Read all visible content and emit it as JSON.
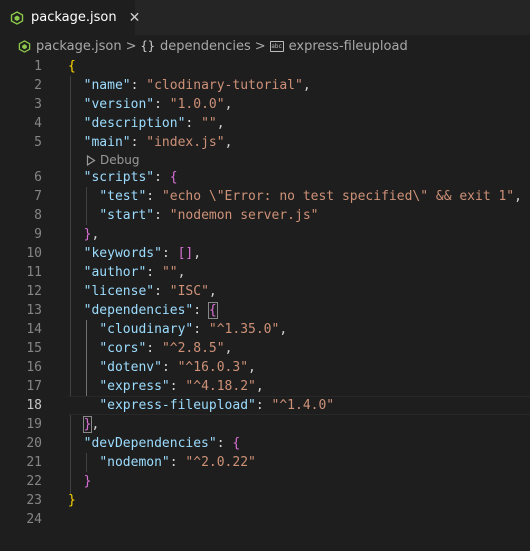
{
  "tab": {
    "filename": "package.json",
    "close_glyph": "✕",
    "icon": "nodejs-icon"
  },
  "breadcrumbs": [
    {
      "label": "package.json",
      "icon": "nodejs-icon"
    },
    {
      "label": "dependencies",
      "icon": "braces-icon"
    },
    {
      "label": "express-fileupload",
      "icon": "string-icon"
    }
  ],
  "breadcrumb_separator": ">",
  "braces_glyph": "{}",
  "string_glyph": "abc",
  "codelens": {
    "label": "Debug",
    "icon": "play-icon"
  },
  "active_line": 18,
  "colors": {
    "background": "#1e1e1e",
    "key": "#9cdcfe",
    "string": "#ce9178",
    "punctuation": "#d4d4d4",
    "bracket_level_1": "#ffd700",
    "bracket_level_2": "#da70d6",
    "bracket_level_3": "#179fff",
    "nodejs_green": "#8cc84b"
  },
  "code": {
    "lines": [
      {
        "n": "1",
        "t": [
          [
            "b1",
            "{"
          ]
        ]
      },
      {
        "n": "2",
        "t": [
          [
            "p",
            "  "
          ],
          [
            "k",
            "\"name\""
          ],
          [
            "p",
            ": "
          ],
          [
            "s",
            "\"clodinary-tutorial\""
          ],
          [
            "p",
            ","
          ]
        ]
      },
      {
        "n": "3",
        "t": [
          [
            "p",
            "  "
          ],
          [
            "k",
            "\"version\""
          ],
          [
            "p",
            ": "
          ],
          [
            "s",
            "\"1.0.0\""
          ],
          [
            "p",
            ","
          ]
        ]
      },
      {
        "n": "4",
        "t": [
          [
            "p",
            "  "
          ],
          [
            "k",
            "\"description\""
          ],
          [
            "p",
            ": "
          ],
          [
            "s",
            "\"\""
          ],
          [
            "p",
            ","
          ]
        ]
      },
      {
        "n": "5",
        "t": [
          [
            "p",
            "  "
          ],
          [
            "k",
            "\"main\""
          ],
          [
            "p",
            ": "
          ],
          [
            "s",
            "\"index.js\""
          ],
          [
            "p",
            ","
          ]
        ]
      },
      {
        "n": "6",
        "t": [
          [
            "p",
            "  "
          ],
          [
            "k",
            "\"scripts\""
          ],
          [
            "p",
            ": "
          ],
          [
            "b2",
            "{"
          ]
        ]
      },
      {
        "n": "7",
        "t": [
          [
            "p",
            "    "
          ],
          [
            "k",
            "\"test\""
          ],
          [
            "p",
            ": "
          ],
          [
            "s",
            "\"echo \\\"Error: no test specified\\\" && exit 1\""
          ],
          [
            "p",
            ","
          ]
        ]
      },
      {
        "n": "8",
        "t": [
          [
            "p",
            "    "
          ],
          [
            "k",
            "\"start\""
          ],
          [
            "p",
            ": "
          ],
          [
            "s",
            "\"nodemon server.js\""
          ]
        ]
      },
      {
        "n": "9",
        "t": [
          [
            "p",
            "  "
          ],
          [
            "b2",
            "}"
          ],
          [
            "p",
            ","
          ]
        ]
      },
      {
        "n": "10",
        "t": [
          [
            "p",
            "  "
          ],
          [
            "k",
            "\"keywords\""
          ],
          [
            "p",
            ": "
          ],
          [
            "b2",
            "[]"
          ],
          [
            "p",
            ","
          ]
        ]
      },
      {
        "n": "11",
        "t": [
          [
            "p",
            "  "
          ],
          [
            "k",
            "\"author\""
          ],
          [
            "p",
            ": "
          ],
          [
            "s",
            "\"\""
          ],
          [
            "p",
            ","
          ]
        ]
      },
      {
        "n": "12",
        "t": [
          [
            "p",
            "  "
          ],
          [
            "k",
            "\"license\""
          ],
          [
            "p",
            ": "
          ],
          [
            "s",
            "\"ISC\""
          ],
          [
            "p",
            ","
          ]
        ]
      },
      {
        "n": "13",
        "t": [
          [
            "p",
            "  "
          ],
          [
            "k",
            "\"dependencies\""
          ],
          [
            "p",
            ": "
          ],
          [
            "b2bm",
            "{"
          ]
        ]
      },
      {
        "n": "14",
        "t": [
          [
            "p",
            "    "
          ],
          [
            "k",
            "\"cloudinary\""
          ],
          [
            "p",
            ": "
          ],
          [
            "s",
            "\"^1.35.0\""
          ],
          [
            "p",
            ","
          ]
        ]
      },
      {
        "n": "15",
        "t": [
          [
            "p",
            "    "
          ],
          [
            "k",
            "\"cors\""
          ],
          [
            "p",
            ": "
          ],
          [
            "s",
            "\"^2.8.5\""
          ],
          [
            "p",
            ","
          ]
        ]
      },
      {
        "n": "16",
        "t": [
          [
            "p",
            "    "
          ],
          [
            "k",
            "\"dotenv\""
          ],
          [
            "p",
            ": "
          ],
          [
            "s",
            "\"^16.0.3\""
          ],
          [
            "p",
            ","
          ]
        ]
      },
      {
        "n": "17",
        "t": [
          [
            "p",
            "    "
          ],
          [
            "k",
            "\"express\""
          ],
          [
            "p",
            ": "
          ],
          [
            "s",
            "\"^4.18.2\""
          ],
          [
            "p",
            ","
          ]
        ]
      },
      {
        "n": "18",
        "t": [
          [
            "p",
            "    "
          ],
          [
            "k",
            "\"express-fileupload\""
          ],
          [
            "p",
            ": "
          ],
          [
            "s",
            "\"^1.4.0\""
          ]
        ]
      },
      {
        "n": "19",
        "t": [
          [
            "p",
            "  "
          ],
          [
            "b2bm",
            "}"
          ],
          [
            "p",
            ","
          ]
        ]
      },
      {
        "n": "20",
        "t": [
          [
            "p",
            "  "
          ],
          [
            "k",
            "\"devDependencies\""
          ],
          [
            "p",
            ": "
          ],
          [
            "b2",
            "{"
          ]
        ]
      },
      {
        "n": "21",
        "t": [
          [
            "p",
            "    "
          ],
          [
            "k",
            "\"nodemon\""
          ],
          [
            "p",
            ": "
          ],
          [
            "s",
            "\"^2.0.22\""
          ]
        ]
      },
      {
        "n": "22",
        "t": [
          [
            "p",
            "  "
          ],
          [
            "b2",
            "}"
          ]
        ]
      },
      {
        "n": "23",
        "t": [
          [
            "b1",
            "}"
          ]
        ]
      },
      {
        "n": "24",
        "t": []
      }
    ]
  }
}
